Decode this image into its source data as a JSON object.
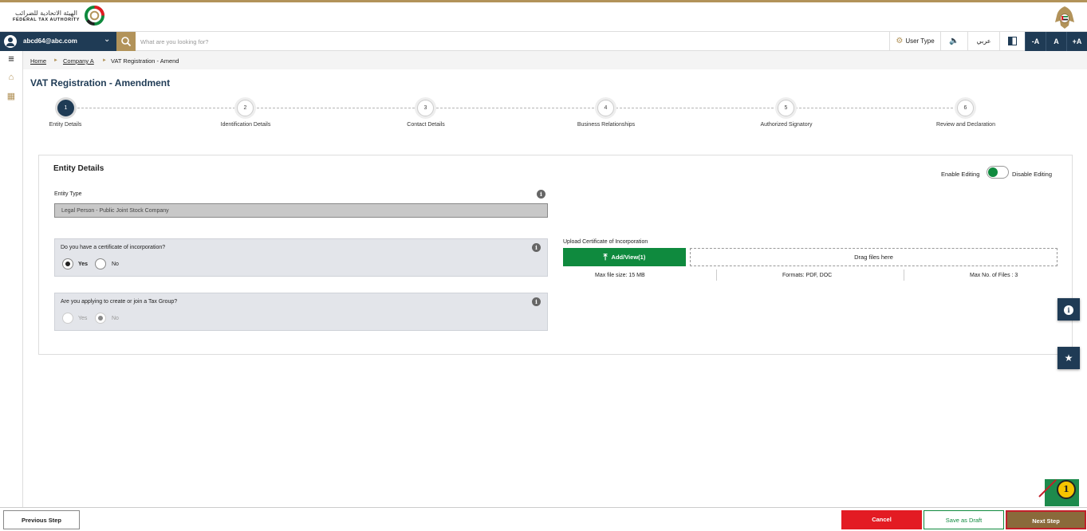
{
  "header": {
    "logo_ar": "الهيئة الاتحادية للضرائب",
    "logo_en": "FEDERAL TAX AUTHORITY"
  },
  "navbar": {
    "user_email": "abcd64@abc.com",
    "search_placeholder": "What are you looking for?",
    "user_type": "User Type",
    "speaker": "🔈",
    "arabic": "عربي",
    "font_decrease": "-A",
    "font_normal": "A",
    "font_increase": "+A"
  },
  "breadcrumb": {
    "items": [
      "Home",
      "Company A",
      "VAT Registration - Amend"
    ],
    "separator": "►"
  },
  "page": {
    "title": "VAT Registration - Amendment"
  },
  "stepper": {
    "active_step": 1,
    "steps": [
      {
        "number": "1",
        "label": "Entity Details"
      },
      {
        "number": "2",
        "label": "Identification Details"
      },
      {
        "number": "3",
        "label": "Contact Details"
      },
      {
        "number": "4",
        "label": "Business Relationships"
      },
      {
        "number": "5",
        "label": "Authorized Signatory"
      },
      {
        "number": "6",
        "label": "Review and Declaration"
      }
    ]
  },
  "section": {
    "title": "Entity Details",
    "enable_editing": "Enable Editing",
    "disable_editing": "Disable Editing",
    "entity_type_label": "Entity Type",
    "entity_type_value": "Legal Person - Public Joint Stock Company",
    "q1": {
      "text": "Do you have a certificate of incorporation?",
      "yes": "Yes",
      "no": "No",
      "selected": "Yes"
    },
    "q2": {
      "text": "Are you applying to create or join a Tax Group?",
      "yes": "Yes",
      "no": "No",
      "selected": "No"
    },
    "upload": {
      "title": "Upload Certificate of Incorporation",
      "button": "Add/View(1)",
      "dropzone": "Drag files here",
      "max_size": "Max file size: 15 MB",
      "formats": "Formats: PDF, DOC",
      "max_files": "Max No. of Files : 3"
    }
  },
  "marker": "1",
  "footer": {
    "previous": "Previous Step",
    "cancel": "Cancel",
    "save_draft": "Save as Draft",
    "next": "Next Step"
  },
  "colors": {
    "navy": "#1f3b55",
    "gold": "#b2935a",
    "green": "#0f8a3e",
    "red": "#e31b23",
    "next_brown": "#8a6a3b"
  }
}
